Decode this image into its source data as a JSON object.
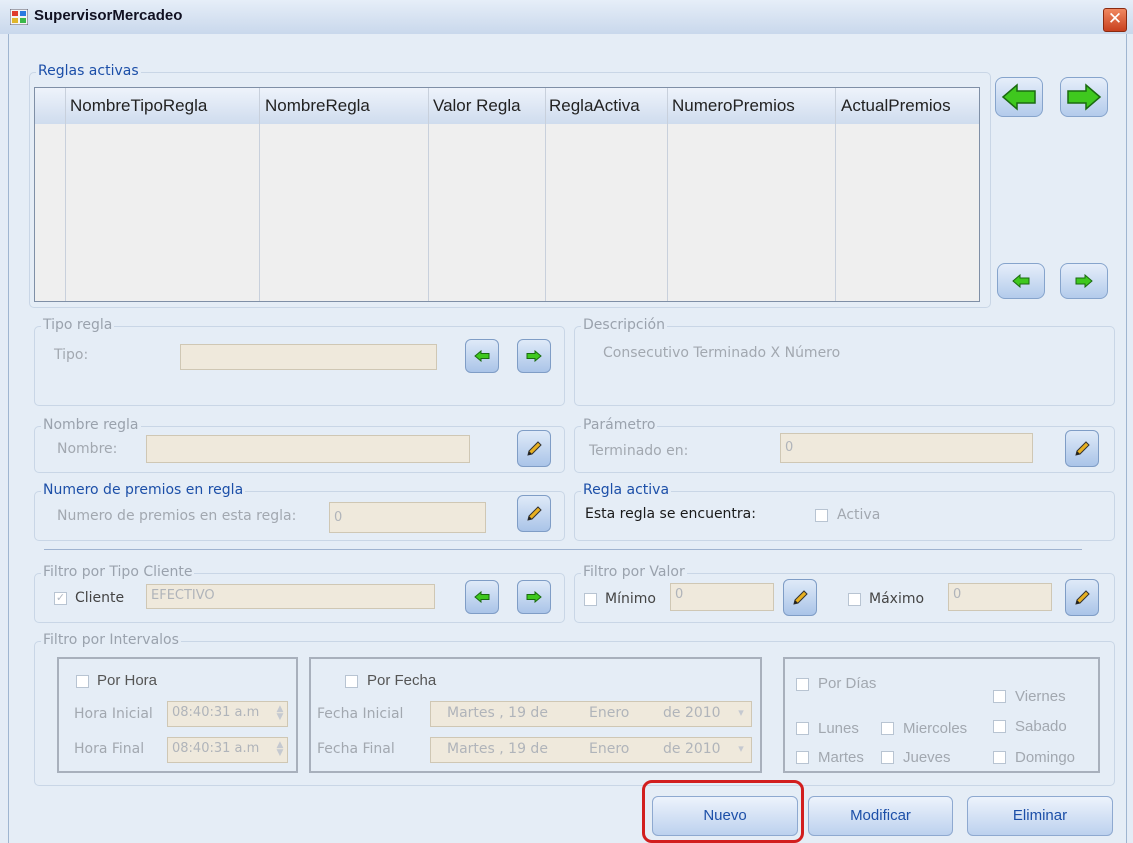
{
  "window": {
    "title": "SupervisorMercadeo"
  },
  "reglas_activas": {
    "legend": "Reglas activas",
    "columns": [
      "NombreTipoRegla",
      "NombreRegla",
      "Valor Regla",
      "ReglaActiva",
      "NumeroPremios",
      "ActualPremios"
    ]
  },
  "tipo_regla": {
    "legend": "Tipo regla",
    "label": "Tipo:",
    "value": ""
  },
  "descripcion": {
    "legend": "Descripción",
    "text": "Consecutivo Terminado X Número"
  },
  "nombre_regla": {
    "legend": "Nombre regla",
    "label": "Nombre:",
    "value": ""
  },
  "parametro": {
    "legend": "Parámetro",
    "label": "Terminado en:",
    "value": "0"
  },
  "numero_premios": {
    "legend": "Numero de premios en regla",
    "label": "Numero de premios en esta regla:",
    "value": "0"
  },
  "regla_activa": {
    "legend": "Regla activa",
    "label": "Esta regla se encuentra:",
    "checkbox_label": "Activa"
  },
  "filtro_tipo_cliente": {
    "legend": "Filtro por Tipo Cliente",
    "checkbox_label": "Cliente",
    "value": "EFECTIVO"
  },
  "filtro_valor": {
    "legend": "Filtro por Valor",
    "min_label": "Mínimo",
    "min_value": "0",
    "max_label": "Máximo",
    "max_value": "0"
  },
  "filtro_intervalos": {
    "legend": "Filtro por Intervalos",
    "por_hora": "Por Hora",
    "hora_inicial_label": "Hora Inicial",
    "hora_inicial_value": "08:40:31 a.m",
    "hora_final_label": "Hora Final",
    "hora_final_value": "08:40:31 a.m",
    "por_fecha": "Por Fecha",
    "fecha_inicial_label": "Fecha Inicial",
    "fecha_final_label": "Fecha Final",
    "fecha": {
      "day": "Martes , 19 de",
      "month": "Enero",
      "year": "de 2010"
    },
    "por_dias": "Por Días",
    "days": {
      "lunes": "Lunes",
      "martes": "Martes",
      "miercoles": "Miercoles",
      "jueves": "Jueves",
      "viernes": "Viernes",
      "sabado": "Sabado",
      "domingo": "Domingo"
    }
  },
  "actions": {
    "nuevo": "Nuevo",
    "modificar": "Modificar",
    "eliminar": "Eliminar"
  },
  "colors": {
    "highlight": "#d21e1e",
    "accent_blue": "#1c4fa8",
    "arrow_green": "#3fc81e"
  }
}
